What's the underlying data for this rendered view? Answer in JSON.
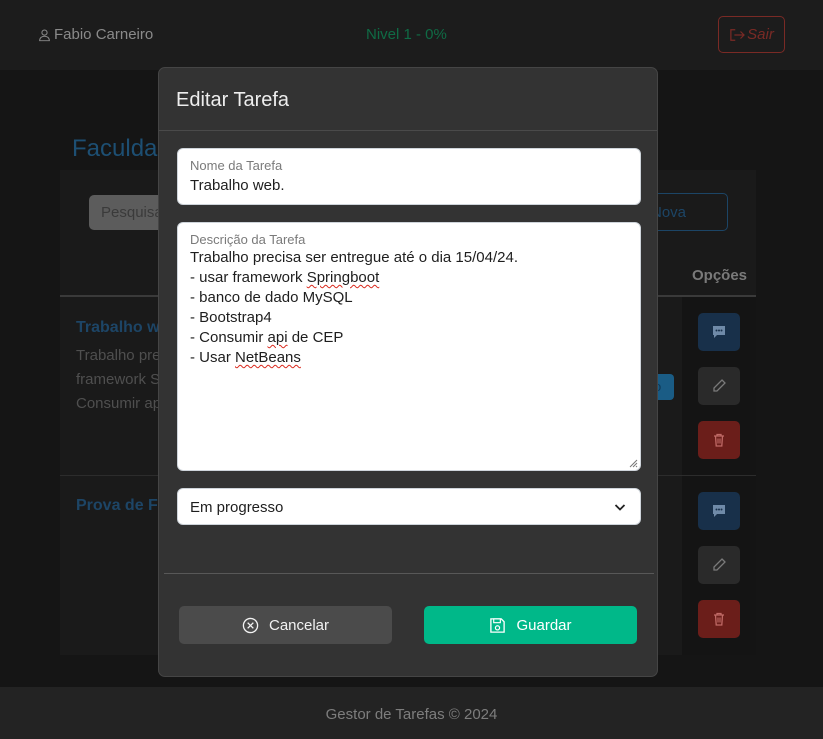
{
  "header": {
    "user_name": "Fabio Carneiro",
    "level": "Nivel 1 - 0%",
    "logout_label": "Sair"
  },
  "page": {
    "section_title": "Faculdad",
    "search_placeholder": "Pesquisa",
    "new_button_label": "Nova",
    "options_header": "Opções",
    "status_chip": "o",
    "tasks": [
      {
        "title": "Trabalho w",
        "description_lines": [
          "Trabalho pre",
          "framework S",
          "Consumir ap"
        ]
      },
      {
        "title": "Prova de F"
      }
    ]
  },
  "footer": {
    "text": "Gestor de Tarefas © 2024"
  },
  "modal": {
    "title": "Editar Tarefa",
    "name_label": "Nome da Tarefa",
    "name_value": "Trabalho web.",
    "description_label": "Descrição da Tarefa",
    "description_lines": [
      "Trabalho precisa ser entregue até o dia 15/04/24.",
      "- usar framework Springboot",
      "- banco de dado MySQL",
      "- Bootstrap4",
      "- Consumir api de CEP",
      "- Usar NetBeans"
    ],
    "status_value": "Em progresso",
    "cancel_label": "Cancelar",
    "save_label": "Guardar"
  },
  "colors": {
    "save_button": "#00b889",
    "cancel_button": "#4b4b4b",
    "modal_bg": "#333333",
    "level_text": "#0f6b45",
    "logout": "#7a2a25"
  },
  "icons": [
    "user-icon",
    "logout-icon",
    "comment-icon",
    "pencil-icon",
    "trash-icon",
    "chevron-down-icon",
    "cancel-circle-icon",
    "save-disk-icon"
  ]
}
